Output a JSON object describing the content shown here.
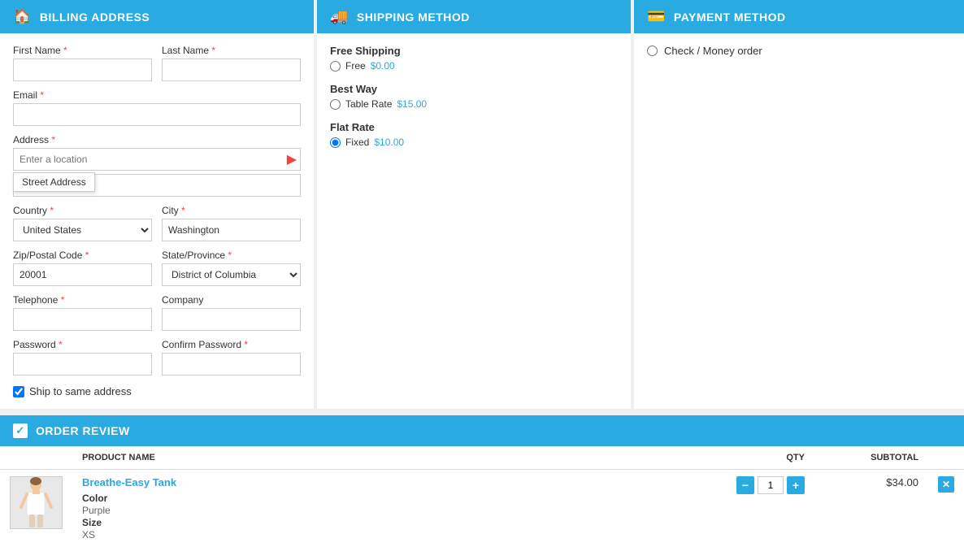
{
  "billing": {
    "header": "BILLING ADDRESS",
    "header_icon": "🏠",
    "first_name_label": "First Name",
    "last_name_label": "Last Name",
    "email_label": "Email",
    "address_label": "Address",
    "address_placeholder": "Enter a location",
    "address_tooltip": "Street Address",
    "country_label": "Country",
    "city_label": "City",
    "city_value": "Washington",
    "zip_label": "Zip/Postal Code",
    "zip_value": "20001",
    "state_label": "State/Province",
    "state_value": "District of Columbia",
    "telephone_label": "Telephone",
    "company_label": "Company",
    "password_label": "Password",
    "confirm_password_label": "Confirm Password",
    "ship_same_label": "Ship to same address",
    "country_default": "United States"
  },
  "shipping": {
    "header": "SHIPPING METHOD",
    "header_icon": "🚚",
    "groups": [
      {
        "title": "Free Shipping",
        "options": [
          {
            "label": "Free",
            "price": "$0.00",
            "selected": false
          }
        ]
      },
      {
        "title": "Best Way",
        "options": [
          {
            "label": "Table Rate",
            "price": "$15.00",
            "selected": false
          }
        ]
      },
      {
        "title": "Flat Rate",
        "options": [
          {
            "label": "Fixed",
            "price": "$10.00",
            "selected": true
          }
        ]
      }
    ]
  },
  "payment": {
    "header": "PAYMENT METHOD",
    "header_icon": "💳",
    "options": [
      {
        "label": "Check / Money order",
        "selected": false
      }
    ]
  },
  "order_review": {
    "header": "ORDER REVIEW",
    "col_product": "PRODUCT NAME",
    "col_qty": "QTY",
    "col_subtotal": "SUBTOTAL",
    "items": [
      {
        "name": "Breathe-Easy Tank",
        "color_label": "Color",
        "color_value": "Purple",
        "size_label": "Size",
        "size_value": "XS",
        "qty": 1,
        "subtotal": "$34.00"
      }
    ]
  }
}
